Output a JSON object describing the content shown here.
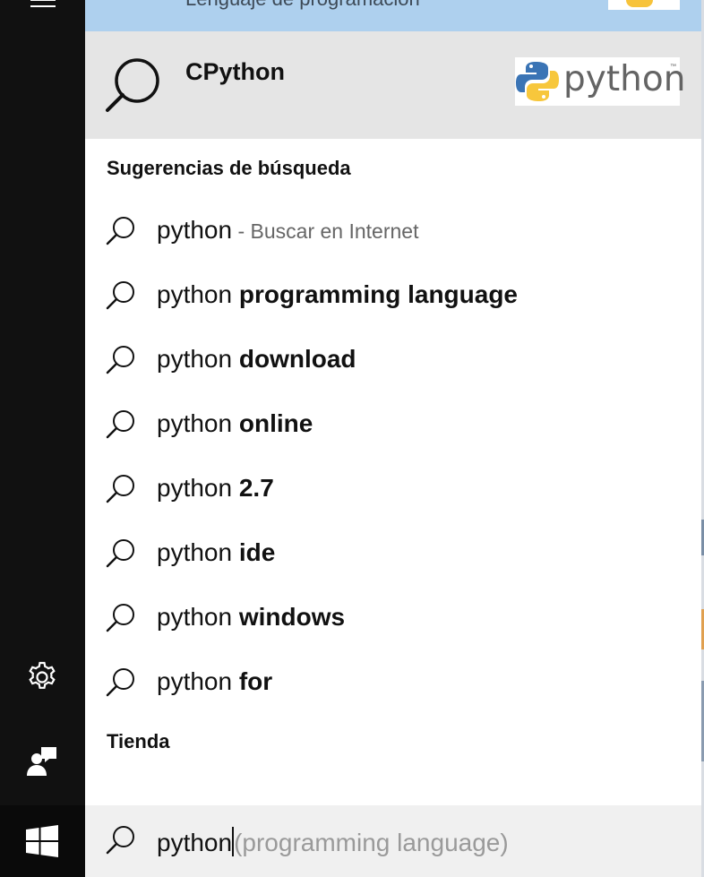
{
  "sidebar": {
    "menu_icon": "hamburger-icon",
    "settings_icon": "gear-icon",
    "feedback_icon": "feedback-icon",
    "start_icon": "windows-logo-icon"
  },
  "top_result": {
    "label": "Lenguaje de programación"
  },
  "best_match": {
    "icon": "search-icon",
    "title": "CPython",
    "logo_text": "python",
    "logo_tm": "™"
  },
  "suggestions_heading": "Sugerencias de búsqueda",
  "suggestions": [
    {
      "query": "python",
      "completion": "",
      "hint": " - Buscar en Internet"
    },
    {
      "query": "python",
      "completion": "programming language",
      "hint": ""
    },
    {
      "query": "python",
      "completion": "download",
      "hint": ""
    },
    {
      "query": "python",
      "completion": "online",
      "hint": ""
    },
    {
      "query": "python",
      "completion": "2.7",
      "hint": ""
    },
    {
      "query": "python",
      "completion": "ide",
      "hint": ""
    },
    {
      "query": "python",
      "completion": "windows",
      "hint": ""
    },
    {
      "query": "python",
      "completion": "for",
      "hint": ""
    }
  ],
  "store_heading": "Tienda",
  "search": {
    "value": "python",
    "autocomplete": "(programming language)",
    "icon": "search-icon"
  }
}
